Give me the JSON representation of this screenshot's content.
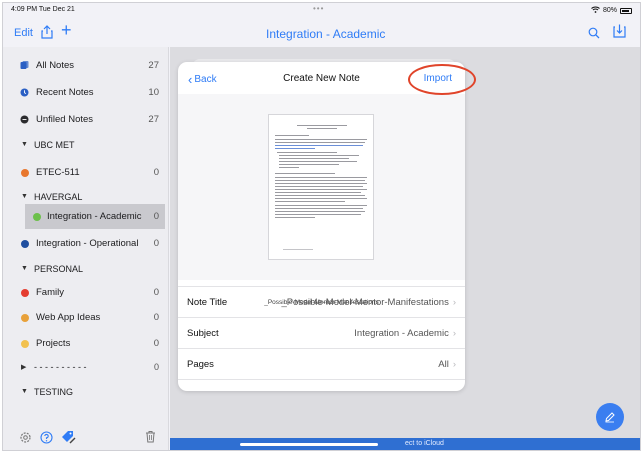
{
  "status": {
    "time": "4:09 PM  Tue Dec 21",
    "dots": "•••",
    "battery": "80%"
  },
  "topbar": {
    "edit_label": "Edit",
    "plus_label": "+",
    "title": "Integration - Academic"
  },
  "sidebar": {
    "items": [
      {
        "label": "All Notes",
        "count": "27",
        "icon": "notes-icon"
      },
      {
        "label": "Recent Notes",
        "count": "10",
        "icon": "clock-icon"
      },
      {
        "label": "Unfiled Notes",
        "count": "27",
        "icon": "unfiled-icon"
      },
      {
        "label": "UBC MET",
        "section": true
      },
      {
        "label": "ETEC-511",
        "count": "0",
        "color": "#e8772e"
      },
      {
        "label": "HAVERGAL",
        "section": true
      },
      {
        "label": "Integration - Academic",
        "count": "0",
        "color": "#6cc04a",
        "selected": true
      },
      {
        "label": "Integration - Operational",
        "count": "0",
        "color": "#1f4fa0"
      },
      {
        "label": "PERSONAL",
        "section": true
      },
      {
        "label": "Family",
        "count": "0",
        "color": "#e43d30"
      },
      {
        "label": "Web App Ideas",
        "count": "0",
        "color": "#e8a13a"
      },
      {
        "label": "Projects",
        "count": "0",
        "color": "#f2c14e"
      },
      {
        "label": "- - - - - - - - - -",
        "count": "0",
        "color": "#cc2f9a"
      },
      {
        "label": "TESTING",
        "section": true
      }
    ]
  },
  "sheet": {
    "back_label": "Back",
    "title": "Create New Note",
    "import_label": "Import",
    "filename": "_Possible-Model-Mentor-Manifestations",
    "fields": [
      {
        "label": "Note Title",
        "value": "_Possible-Model-Mentor-Manifestations"
      },
      {
        "label": "Subject",
        "value": "Integration - Academic"
      },
      {
        "label": "Pages",
        "value": "All"
      }
    ]
  },
  "bottombar": {
    "text": "ect to iCloud"
  },
  "colors": {
    "accent": "#2f7cf6",
    "annotation": "#e0442a"
  }
}
